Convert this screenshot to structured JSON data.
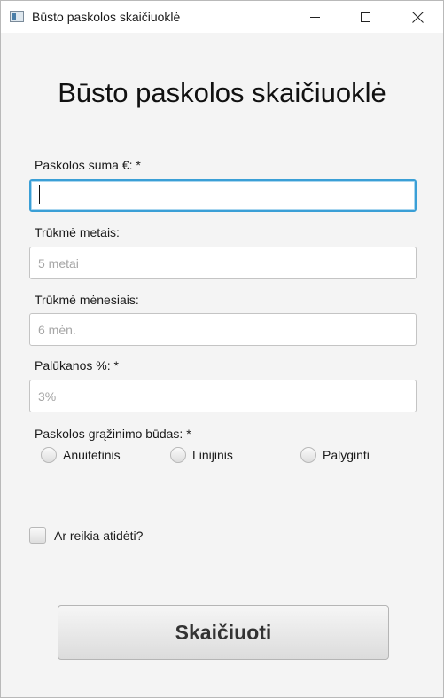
{
  "window": {
    "title": "Būsto paskolos skaičiuoklė",
    "icon": "java-app-icon"
  },
  "heading": "Būsto paskolos skaičiuoklė",
  "form": {
    "amount": {
      "label": "Paskolos suma €: *",
      "value": "",
      "placeholder": ""
    },
    "years": {
      "label": "Trūkmė metais:",
      "value": "",
      "placeholder": "5 metai"
    },
    "months": {
      "label": "Trūkmė mėnesiais:",
      "value": "",
      "placeholder": "6 mėn."
    },
    "interest": {
      "label": "Palūkanos %: *",
      "value": "",
      "placeholder": "3%"
    },
    "repayment": {
      "label": "Paskolos grąžinimo būdas: *",
      "options": [
        "Anuitetinis",
        "Linijinis",
        "Palyginti"
      ],
      "selected": null
    },
    "deferral": {
      "label": "Ar reikia atidėti?",
      "checked": false
    },
    "submit_label": "Skaičiuoti"
  },
  "colors": {
    "focus_border": "#3a9fd6",
    "background": "#f4f4f4"
  }
}
